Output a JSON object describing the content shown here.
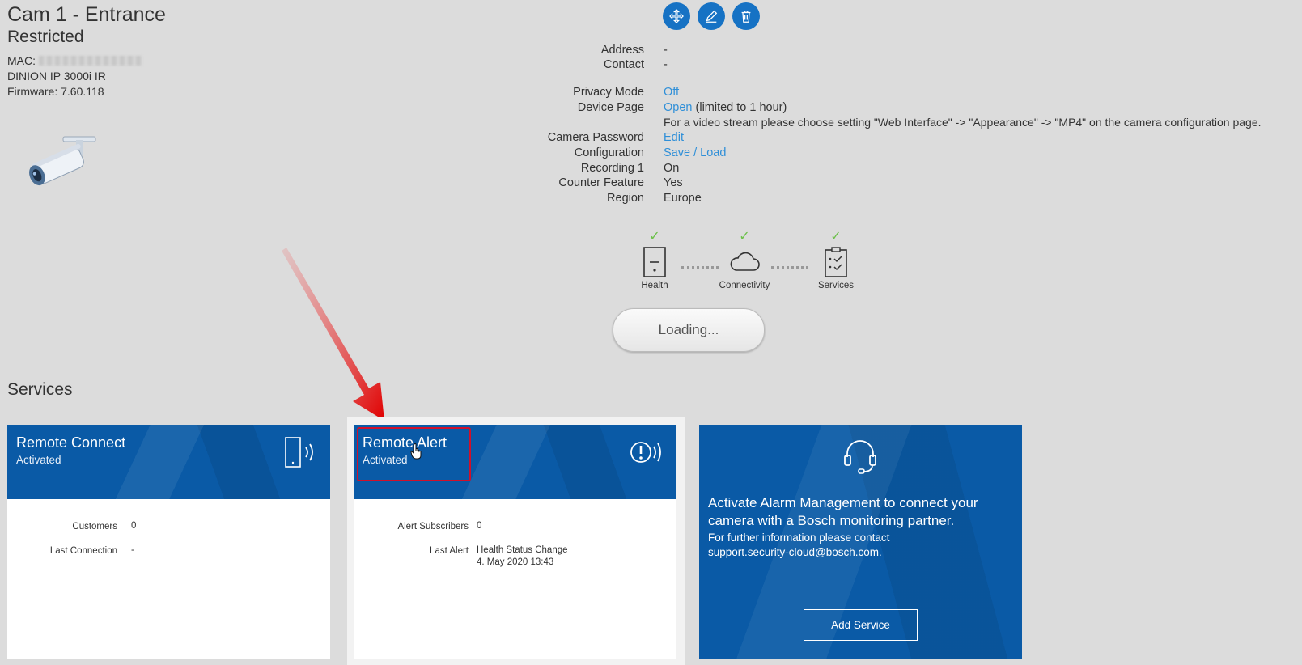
{
  "header": {
    "title": "Cam 1 - Entrance",
    "subtitle": "Restricted",
    "mac_label": "MAC:",
    "model": "DINION IP 3000i IR",
    "firmware": "Firmware: 7.60.118"
  },
  "toolbar": {
    "move_icon": "move-icon",
    "edit_icon": "pencil-icon",
    "delete_icon": "trash-icon"
  },
  "details": {
    "address_label": "Address",
    "address_value": "-",
    "contact_label": "Contact",
    "contact_value": "-",
    "privacy_label": "Privacy Mode",
    "privacy_value": "Off",
    "device_page_label": "Device Page",
    "device_page_link": "Open",
    "device_page_note": "(limited to 1 hour)",
    "video_note": "For a video stream please choose setting \"Web Interface\" -> \"Appearance\" -> \"MP4\" on the camera configuration page.",
    "camera_password_label": "Camera Password",
    "camera_password_link": "Edit",
    "configuration_label": "Configuration",
    "configuration_link": "Save / Load",
    "recording_label": "Recording 1",
    "recording_value": "On",
    "counter_label": "Counter Feature",
    "counter_value": "Yes",
    "region_label": "Region",
    "region_value": "Europe"
  },
  "status": {
    "health": "Health",
    "connectivity": "Connectivity",
    "services": "Services",
    "loading": "Loading...",
    "check_color": "#6cc04a"
  },
  "services": {
    "heading": "Services",
    "remote_connect": {
      "title": "Remote Connect",
      "status": "Activated",
      "customers_label": "Customers",
      "customers_value": "0",
      "last_connection_label": "Last Connection",
      "last_connection_value": "-"
    },
    "remote_alert": {
      "title": "Remote Alert",
      "status": "Activated",
      "subscribers_label": "Alert Subscribers",
      "subscribers_value": "0",
      "last_alert_label": "Last Alert",
      "last_alert_value": "Health Status Change",
      "last_alert_date": "4. May 2020 13:43"
    },
    "alarm": {
      "text": "Activate Alarm Management to connect your camera with a Bosch monitoring partner.",
      "info": "For further information please contact",
      "email": "support.security-cloud@bosch.com.",
      "button": "Add Service"
    }
  },
  "colors": {
    "brand_blue": "#0a5aa6",
    "button_blue": "#1672c4",
    "link": "#2f8fd8",
    "highlight": "#d0102a"
  }
}
